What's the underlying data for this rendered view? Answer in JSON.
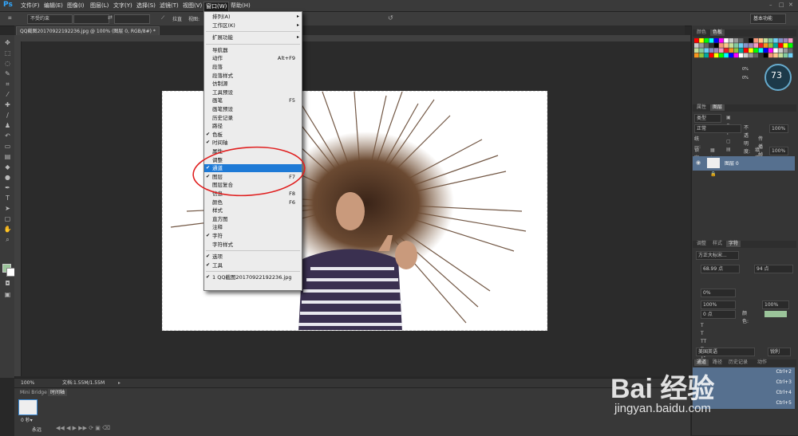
{
  "app": {
    "logo": "Ps"
  },
  "menubar": {
    "items": [
      "文件(F)",
      "编辑(E)",
      "图像(I)",
      "图层(L)",
      "文字(Y)",
      "选择(S)",
      "滤镜(T)",
      "视图(V)",
      "窗口(W)",
      "帮助(H)"
    ],
    "active": "窗口(W)"
  },
  "optionsbar": {
    "preset": "不受约束",
    "straighten_label": "拉直",
    "view_label": "视图:"
  },
  "document": {
    "tab_title": "QQ截图20170922192236.jpg @ 100% (图层 0, RGB/8#) *"
  },
  "window_menu": {
    "items": [
      {
        "label": "排列(A)",
        "submenu": true
      },
      {
        "label": "工作区(K)",
        "submenu": true
      },
      {
        "sep": true
      },
      {
        "label": "扩展功能",
        "submenu": true
      },
      {
        "sep": true
      },
      {
        "label": "导航器"
      },
      {
        "label": "动作",
        "shortcut": "Alt+F9"
      },
      {
        "label": "段落"
      },
      {
        "label": "段落样式"
      },
      {
        "label": "仿制源"
      },
      {
        "label": "工具预设"
      },
      {
        "label": "画笔",
        "shortcut": "F5"
      },
      {
        "label": "画笔预设"
      },
      {
        "label": "历史记录"
      },
      {
        "label": "路径"
      },
      {
        "label": "色板",
        "checked": true
      },
      {
        "label": "时间轴",
        "checked": true
      },
      {
        "label": "属性"
      },
      {
        "label": "调整"
      },
      {
        "label": "通道",
        "checked": true,
        "highlighted": true
      },
      {
        "label": "图层",
        "checked": true,
        "shortcut": "F7"
      },
      {
        "label": "图层复合"
      },
      {
        "label": "信息",
        "shortcut": "F8"
      },
      {
        "label": "颜色",
        "shortcut": "F6"
      },
      {
        "label": "样式"
      },
      {
        "label": "直方图"
      },
      {
        "label": "注释"
      },
      {
        "label": "字符",
        "checked": true
      },
      {
        "label": "字符样式"
      },
      {
        "sep": true
      },
      {
        "label": "选项",
        "checked": true
      },
      {
        "label": "工具",
        "checked": true
      },
      {
        "sep": true
      },
      {
        "label": "1 QQ截图20170922192236.jpg",
        "checked": true
      }
    ]
  },
  "statusbar": {
    "zoom": "100%",
    "doc_info": "文档:1.55M/1.55M"
  },
  "bottom_panel": {
    "tabs": [
      "Mini Bridge",
      "时间轴"
    ],
    "frame_time": "0 秒▾",
    "loop": "永远"
  },
  "right_panels": {
    "workspace": "基本功能",
    "swatch_tabs": [
      "颜色",
      "色板"
    ],
    "gauge_value": "73",
    "gauge_percent_1": "0%",
    "gauge_percent_2": "0%",
    "layers_tabs": [
      "属性",
      "图层"
    ],
    "layer_kind": "类型",
    "blend_mode": "正常",
    "opacity_label": "不透明度:",
    "opacity_value": "100%",
    "lock_label": "锁定:",
    "fill_label": "填充:",
    "fill_value": "100%",
    "propagate_label": "传播帧 1",
    "unify_label": "统一:",
    "layer_name": "图层 0",
    "char_tabs": [
      "调整",
      "样式",
      "字符"
    ],
    "font_family": "方正大标宋...",
    "font_size": "68.99 点",
    "leading": "94 点",
    "tracking": "0%",
    "scale_v": "100%",
    "scale_h": "100%",
    "baseline": "0 点",
    "color_label": "颜色:",
    "language": "美国英语",
    "antialias": "锐利",
    "channels_tabs": [
      "通道",
      "路径",
      "历史记录",
      "动作"
    ],
    "channel_shortcuts": [
      "Ctrl+2",
      "Ctrl+3",
      "Ctrl+4",
      "Ctrl+5"
    ]
  },
  "watermark": {
    "brand": "Bai 经验",
    "url": "jingyan.baidu.com"
  },
  "colors": {
    "highlight": "#1e7ad6",
    "annotation_circle": "#e02020",
    "app_bg": "#282828"
  }
}
